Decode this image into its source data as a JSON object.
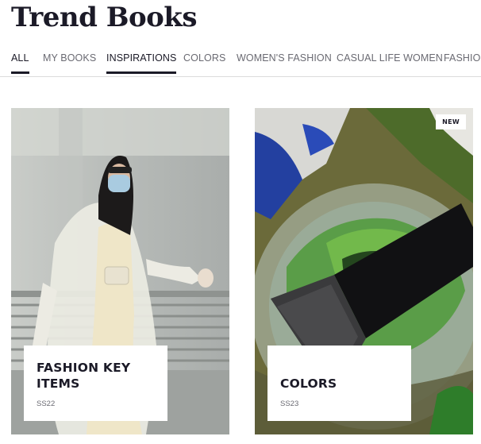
{
  "header": {
    "title": "Trend Books"
  },
  "tabs": [
    {
      "label": "ALL",
      "active": true
    },
    {
      "label": "MY BOOKS",
      "active": false
    },
    {
      "label": "INSPIRATIONS",
      "active": true
    },
    {
      "label": "COLORS",
      "active": false
    },
    {
      "label": "WOMEN'S FASHION",
      "active": false
    },
    {
      "label": "CASUAL LIFE WOMEN",
      "active": false
    },
    {
      "label": "FASHION",
      "active": false
    }
  ],
  "cards": [
    {
      "title": "FASHION KEY ITEMS",
      "season": "SS22",
      "badge": ""
    },
    {
      "title": "COLORS",
      "season": "SS23",
      "badge": "NEW"
    }
  ]
}
